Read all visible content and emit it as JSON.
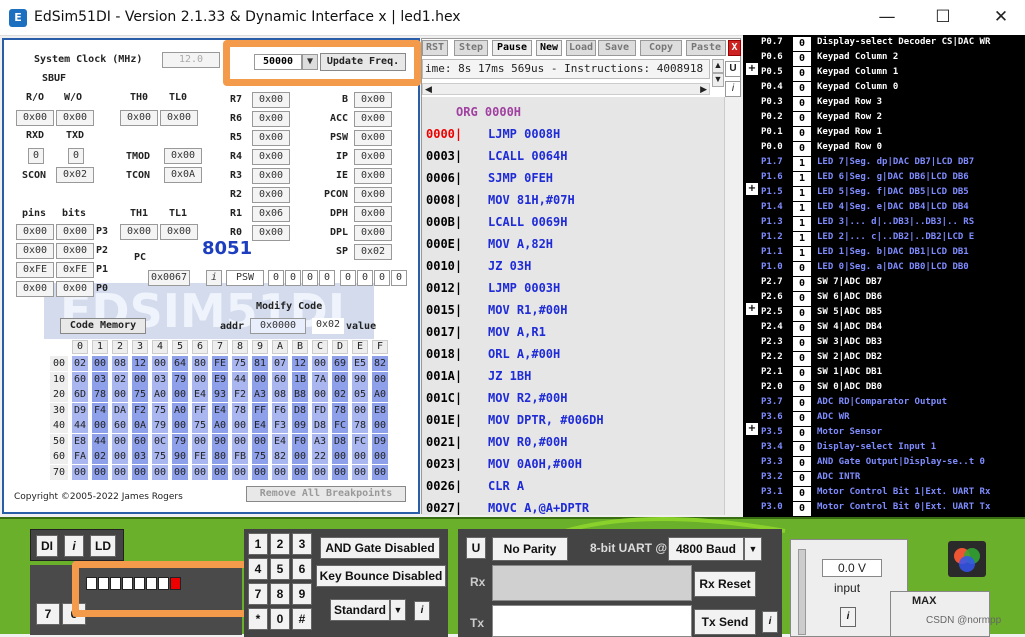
{
  "window": {
    "title": "EdSim51DI - Version 2.1.33 & Dynamic Interface x | led1.hex",
    "minimize": "—",
    "maximize": "☐",
    "close": "✕"
  },
  "left": {
    "sysclock_label": "System Clock (MHz)",
    "sysclock_value": "12.0",
    "freq_value": "50000",
    "update_label": "Update Freq.",
    "sbuf": "SBUF",
    "ro": "R/O",
    "wo": "W/O",
    "ro_val": "0x00",
    "wo_val": "0x00",
    "th0": "TH0",
    "tl0": "TL0",
    "th0_val": "0x00",
    "tl0_val": "0x00",
    "rxd": "RXD",
    "txd": "TXD",
    "rxd_val": "0",
    "txd_val": "0",
    "scon": "SCON",
    "scon_val": "0x02",
    "tmod": "TMOD",
    "tmod_val": "0x00",
    "tcon": "TCON",
    "tcon_val": "0x0A",
    "pins": "pins",
    "bits": "bits",
    "th1": "TH1",
    "tl1": "TL1",
    "th1_val": "0x00",
    "tl1_val": "0x00",
    "chip": "8051",
    "pc_label": "PC",
    "pc_val": "0x0067",
    "psw_label": "PSW",
    "psw_bits": [
      "0",
      "0",
      "0",
      "0",
      "0",
      "0",
      "0",
      "0"
    ],
    "ports": [
      {
        "pin": "0x00",
        "bit": "0x00",
        "name": "P3"
      },
      {
        "pin": "0x00",
        "bit": "0x00",
        "name": "P2"
      },
      {
        "pin": "0xFE",
        "bit": "0xFE",
        "name": "P1"
      },
      {
        "pin": "0x00",
        "bit": "0x00",
        "name": "P0"
      }
    ],
    "rregs": [
      {
        "n": "R7",
        "v": "0x00"
      },
      {
        "n": "R6",
        "v": "0x00"
      },
      {
        "n": "R5",
        "v": "0x00"
      },
      {
        "n": "R4",
        "v": "0x00"
      },
      {
        "n": "R3",
        "v": "0x00"
      },
      {
        "n": "R2",
        "v": "0x00"
      },
      {
        "n": "R1",
        "v": "0x06"
      },
      {
        "n": "R0",
        "v": "0x00"
      }
    ],
    "sregs": [
      {
        "n": "B",
        "v": "0x00"
      },
      {
        "n": "ACC",
        "v": "0x00"
      },
      {
        "n": "PSW",
        "v": "0x00"
      },
      {
        "n": "IP",
        "v": "0x00"
      },
      {
        "n": "IE",
        "v": "0x00"
      },
      {
        "n": "PCON",
        "v": "0x00"
      },
      {
        "n": "DPH",
        "v": "0x00"
      },
      {
        "n": "DPL",
        "v": "0x00"
      },
      {
        "n": "SP",
        "v": "0x02"
      }
    ],
    "modify_code": "Modify Code",
    "addr_label": "addr",
    "addr_val": "0x0000",
    "mod_val": "0x02",
    "value_label": "value",
    "code_memory_btn": "Code Memory",
    "watermark": "EDSIM51DI",
    "info": "i",
    "mem_cols": [
      "0",
      "1",
      "2",
      "3",
      "4",
      "5",
      "6",
      "7",
      "8",
      "9",
      "A",
      "B",
      "C",
      "D",
      "E",
      "F"
    ],
    "mem_rows": [
      {
        "a": "00",
        "v": [
          "02",
          "00",
          "08",
          "12",
          "00",
          "64",
          "80",
          "FE",
          "75",
          "81",
          "07",
          "12",
          "00",
          "69",
          "E5",
          "82"
        ]
      },
      {
        "a": "10",
        "v": [
          "60",
          "03",
          "02",
          "00",
          "03",
          "79",
          "00",
          "E9",
          "44",
          "00",
          "60",
          "1B",
          "7A",
          "00",
          "90",
          "00"
        ]
      },
      {
        "a": "20",
        "v": [
          "6D",
          "78",
          "00",
          "75",
          "A0",
          "00",
          "E4",
          "93",
          "F2",
          "A3",
          "08",
          "B8",
          "00",
          "02",
          "05",
          "A0"
        ]
      },
      {
        "a": "30",
        "v": [
          "D9",
          "F4",
          "DA",
          "F2",
          "75",
          "A0",
          "FF",
          "E4",
          "78",
          "FF",
          "F6",
          "D8",
          "FD",
          "78",
          "00",
          "E8"
        ]
      },
      {
        "a": "40",
        "v": [
          "44",
          "00",
          "60",
          "0A",
          "79",
          "00",
          "75",
          "A0",
          "00",
          "E4",
          "F3",
          "09",
          "D8",
          "FC",
          "78",
          "00"
        ]
      },
      {
        "a": "50",
        "v": [
          "E8",
          "44",
          "00",
          "60",
          "0C",
          "79",
          "00",
          "90",
          "00",
          "00",
          "E4",
          "F0",
          "A3",
          "D8",
          "FC",
          "D9"
        ]
      },
      {
        "a": "60",
        "v": [
          "FA",
          "02",
          "00",
          "03",
          "75",
          "90",
          "FE",
          "80",
          "FB",
          "75",
          "82",
          "00",
          "22",
          "00",
          "00",
          "00"
        ]
      },
      {
        "a": "70",
        "v": [
          "00",
          "00",
          "00",
          "00",
          "00",
          "00",
          "00",
          "00",
          "00",
          "00",
          "00",
          "00",
          "00",
          "00",
          "00",
          "00"
        ]
      }
    ],
    "copyright": "Copyright ©2005-2022 James Rogers",
    "remove_bp": "Remove All Breakpoints"
  },
  "mid": {
    "toolbar": [
      "RST",
      "Step",
      "Pause",
      "New",
      "Load",
      "Save",
      "Copy",
      "Paste"
    ],
    "x": "X",
    "u": "U",
    "i": "i",
    "status": "ime: 8s 17ms 569us - Instructions: 4008918",
    "code": [
      {
        "a": "",
        "t": "ORG 0000H",
        "c": "org"
      },
      {
        "a": "0000|",
        "t": "LJMP 0008H",
        "c": "red"
      },
      {
        "a": "0003|",
        "t": "LCALL 0064H"
      },
      {
        "a": "0006|",
        "t": "SJMP 0FEH"
      },
      {
        "a": "0008|",
        "t": "MOV 81H,#07H"
      },
      {
        "a": "000B|",
        "t": "LCALL 0069H"
      },
      {
        "a": "000E|",
        "t": "MOV A,82H"
      },
      {
        "a": "0010|",
        "t": "JZ 03H"
      },
      {
        "a": "0012|",
        "t": "LJMP 0003H"
      },
      {
        "a": "0015|",
        "t": "MOV R1,#00H"
      },
      {
        "a": "0017|",
        "t": "MOV A,R1"
      },
      {
        "a": "0018|",
        "t": "ORL A,#00H"
      },
      {
        "a": "001A|",
        "t": "JZ 1BH"
      },
      {
        "a": "001C|",
        "t": "MOV R2,#00H"
      },
      {
        "a": "001E|",
        "t": "MOV DPTR, #006DH"
      },
      {
        "a": "0021|",
        "t": "MOV R0,#00H"
      },
      {
        "a": "0023|",
        "t": "MOV 0A0H,#00H"
      },
      {
        "a": "0026|",
        "t": "CLR A"
      },
      {
        "a": "0027|",
        "t": "MOVC A,@A+DPTR"
      }
    ]
  },
  "right": {
    "rows": [
      {
        "p": "P0.7",
        "v": "0",
        "d": "Display-select Decoder CS|DAC WR",
        "c": "w"
      },
      {
        "p": "P0.6",
        "v": "0",
        "d": "Keypad Column 2",
        "c": "w"
      },
      {
        "p": "P0.5",
        "v": "0",
        "d": "Keypad Column 1",
        "c": "w"
      },
      {
        "p": "P0.4",
        "v": "0",
        "d": "Keypad Column 0",
        "c": "w"
      },
      {
        "p": "P0.3",
        "v": "0",
        "d": "Keypad Row 3",
        "c": "w"
      },
      {
        "p": "P0.2",
        "v": "0",
        "d": "Keypad Row 2",
        "c": "w"
      },
      {
        "p": "P0.1",
        "v": "0",
        "d": "Keypad Row 1",
        "c": "w"
      },
      {
        "p": "P0.0",
        "v": "0",
        "d": "Keypad Row 0",
        "c": "w"
      },
      {
        "p": "P1.7",
        "v": "1",
        "d": "LED 7|Seg. dp|DAC DB7|LCD DB7",
        "c": "b"
      },
      {
        "p": "P1.6",
        "v": "1",
        "d": "LED 6|Seg. g|DAC DB6|LCD DB6",
        "c": "b"
      },
      {
        "p": "P1.5",
        "v": "1",
        "d": "LED 5|Seg. f|DAC DB5|LCD DB5",
        "c": "b"
      },
      {
        "p": "P1.4",
        "v": "1",
        "d": "LED 4|Seg. e|DAC DB4|LCD DB4",
        "c": "b"
      },
      {
        "p": "P1.3",
        "v": "1",
        "d": "LED 3|... d|..DB3|..DB3|.. RS",
        "c": "b"
      },
      {
        "p": "P1.2",
        "v": "1",
        "d": "LED 2|... c|..DB2|..DB2|LCD E",
        "c": "b"
      },
      {
        "p": "P1.1",
        "v": "1",
        "d": "LED 1|Seg. b|DAC DB1|LCD DB1",
        "c": "b"
      },
      {
        "p": "P1.0",
        "v": "0",
        "d": "LED 0|Seg. a|DAC DB0|LCD DB0",
        "c": "b"
      },
      {
        "p": "P2.7",
        "v": "0",
        "d": "SW 7|ADC DB7",
        "c": "w"
      },
      {
        "p": "P2.6",
        "v": "0",
        "d": "SW 6|ADC DB6",
        "c": "w"
      },
      {
        "p": "P2.5",
        "v": "0",
        "d": "SW 5|ADC DB5",
        "c": "w"
      },
      {
        "p": "P2.4",
        "v": "0",
        "d": "SW 4|ADC DB4",
        "c": "w"
      },
      {
        "p": "P2.3",
        "v": "0",
        "d": "SW 3|ADC DB3",
        "c": "w"
      },
      {
        "p": "P2.2",
        "v": "0",
        "d": "SW 2|ADC DB2",
        "c": "w"
      },
      {
        "p": "P2.1",
        "v": "0",
        "d": "SW 1|ADC DB1",
        "c": "w"
      },
      {
        "p": "P2.0",
        "v": "0",
        "d": "SW 0|ADC DB0",
        "c": "w"
      },
      {
        "p": "P3.7",
        "v": "0",
        "d": "ADC RD|Comparator Output",
        "c": "b"
      },
      {
        "p": "P3.6",
        "v": "0",
        "d": "ADC WR",
        "c": "b"
      },
      {
        "p": "P3.5",
        "v": "0",
        "d": "Motor Sensor",
        "c": "b"
      },
      {
        "p": "P3.4",
        "v": "0",
        "d": "Display-select Input 1",
        "c": "b"
      },
      {
        "p": "P3.3",
        "v": "0",
        "d": "AND Gate Output|Display-se..t 0",
        "c": "b"
      },
      {
        "p": "P3.2",
        "v": "0",
        "d": "ADC INTR",
        "c": "b"
      },
      {
        "p": "P3.1",
        "v": "0",
        "d": "Motor Control Bit 1|Ext. UART Rx",
        "c": "b"
      },
      {
        "p": "P3.0",
        "v": "0",
        "d": "Motor Control Bit 0|Ext. UART Tx",
        "c": "b"
      }
    ]
  },
  "bottom": {
    "di": "DI",
    "i": "i",
    "ld": "LD",
    "sw_nums": [
      "7",
      "6"
    ],
    "keypad": [
      "1",
      "2",
      "3",
      "4",
      "5",
      "6",
      "7",
      "8",
      "9",
      "*",
      "0",
      "#"
    ],
    "and_gate": "AND Gate Disabled",
    "key_bounce": "Key Bounce Disabled",
    "standard": "Standard",
    "u": "U",
    "parity": "No Parity",
    "uart_label": "8-bit UART @",
    "baud": "4800 Baud",
    "rx": "Rx",
    "tx": "Tx",
    "rx_reset": "Rx Reset",
    "tx_send": "Tx Send",
    "voltage": "0.0 V",
    "input": "input",
    "max": "MAX",
    "watermark": "CSDN @normpp"
  }
}
